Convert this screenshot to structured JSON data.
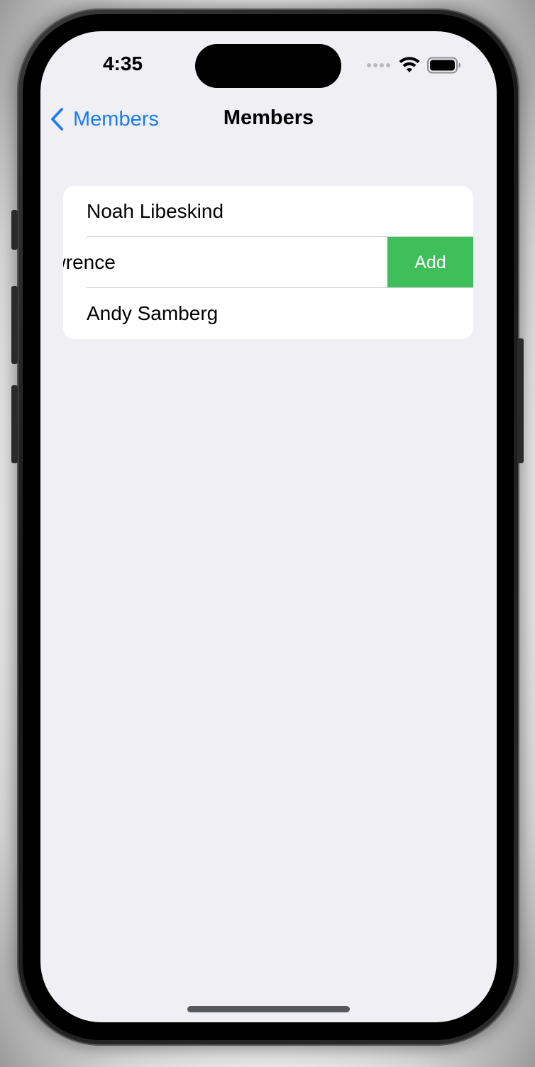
{
  "status_bar": {
    "time": "4:35",
    "signal_icon": "signal-dots-icon",
    "wifi_icon": "wifi-icon",
    "battery_icon": "battery-icon"
  },
  "nav_bar": {
    "back_label": "Members",
    "back_icon": "chevron-left-icon",
    "title": "Members"
  },
  "members": {
    "rows": [
      {
        "label": "Noah Libeskind"
      },
      {
        "label": "Jennifer Lawrence",
        "swipe_action": "Add",
        "swiped": true
      },
      {
        "label": "Andy Samberg"
      }
    ]
  },
  "colors": {
    "accent": "#1a7cf5",
    "swipe_action": "#3ebf5a",
    "background": "#efeff4",
    "cell": "#ffffff"
  }
}
